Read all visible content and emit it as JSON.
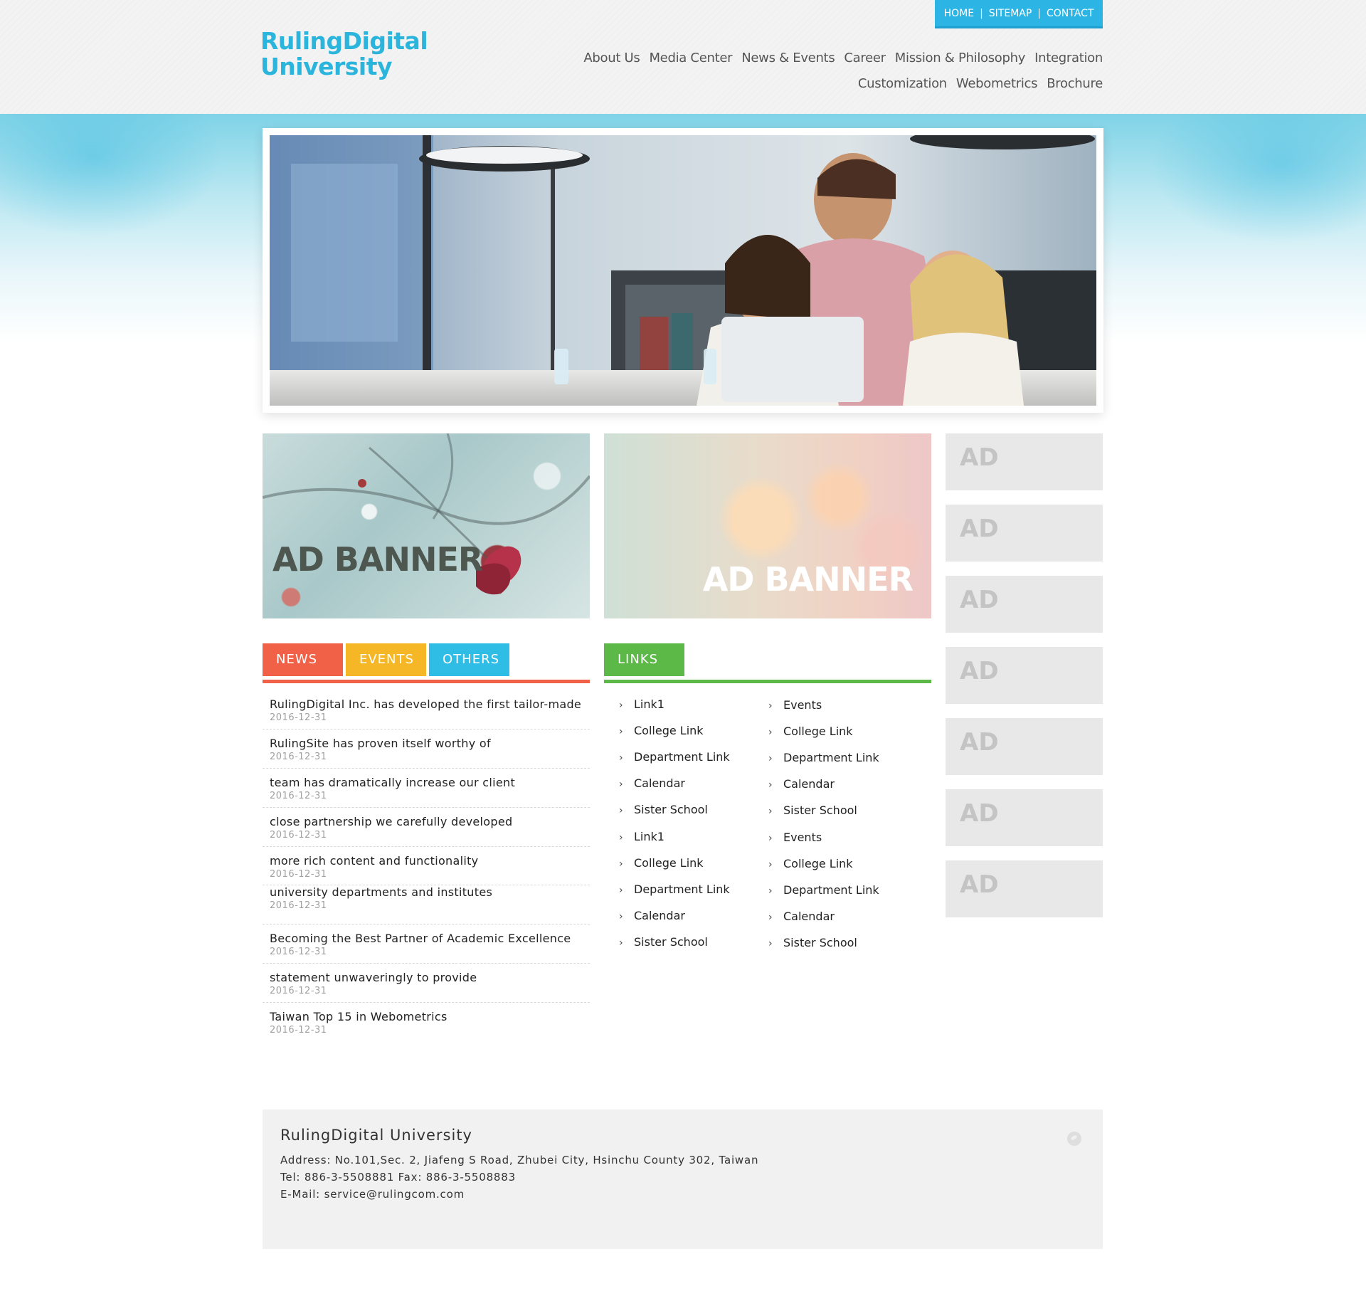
{
  "logo": {
    "line1": "RulingDigital",
    "line2": "University"
  },
  "top_links": [
    "HOME",
    "SITEMAP",
    "CONTACT"
  ],
  "top_links_separator": "|",
  "nav": [
    "About Us",
    "Media Center",
    "News & Events",
    "Career",
    "Mission & Philosophy",
    "Integration",
    "Customization",
    "Webometrics",
    "Brochure"
  ],
  "ad_banners": [
    "AD BANNER",
    "AD BANNER"
  ],
  "side_ads": [
    "AD",
    "AD",
    "AD",
    "AD",
    "AD",
    "AD",
    "AD"
  ],
  "tabs": [
    {
      "label": "NEWS",
      "color": "#f06148"
    },
    {
      "label": "EVENTS",
      "color": "#f5b726"
    },
    {
      "label": "OTHERS",
      "color": "#2fbde6"
    }
  ],
  "links_tab": {
    "label": "LINKS",
    "color": "#5cb847"
  },
  "news": [
    {
      "title": "RulingDigital Inc. has developed the first tailor-made",
      "date": "2016-12-31"
    },
    {
      "title": "RulingSite has proven itself worthy of",
      "date": "2016-12-31"
    },
    {
      "title": "team has dramatically increase our client",
      "date": "2016-12-31"
    },
    {
      "title": "close partnership we carefully developed",
      "date": "2016-12-31"
    },
    {
      "title": "more rich content and functionality",
      "date": "2016-12-31"
    },
    {
      "title": "university departments and institutes",
      "date": "2016-12-31"
    },
    {
      "title": "Becoming the Best Partner of Academic Excellence",
      "date": "2016-12-31"
    },
    {
      "title": "statement unwaveringly to provide",
      "date": "2016-12-31"
    },
    {
      "title": "Taiwan Top 15 in Webometrics",
      "date": "2016-12-31"
    }
  ],
  "links_left": [
    "Link1",
    "College Link",
    "Department Link",
    "Calendar",
    "Sister School",
    "Link1",
    "College Link",
    "Department Link",
    "Calendar",
    "Sister School"
  ],
  "links_right": [
    "Events",
    "College Link",
    "Department Link",
    "Calendar",
    "Sister School",
    "Events",
    "College Link",
    "Department Link",
    "Calendar",
    "Sister School"
  ],
  "footer": {
    "title": "RulingDigital University",
    "address": "Address: No.101,Sec. 2, Jiafeng S Road, Zhubei City, Hsinchu County 302, Taiwan",
    "tel": "Tel: 886-3-5508881  Fax: 886-3-5508883",
    "email": "E-Mail: service@rulingcom.com"
  },
  "icons": {
    "link_chevron": "chevron-right-icon",
    "footer": "globe-icon"
  }
}
